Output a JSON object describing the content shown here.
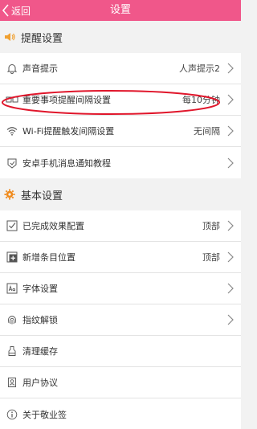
{
  "header": {
    "back_label": "返回",
    "title": "设置"
  },
  "sections": {
    "reminder": {
      "title": "提醒设置",
      "rows": [
        {
          "label": "声音提示",
          "value": "人声提示2"
        },
        {
          "label": "重要事项提醒间隔设置",
          "value": "每10分钟"
        },
        {
          "label": "Wi-Fi提醒触发间隔设置",
          "value": "无间隔"
        },
        {
          "label": "安卓手机消息通知教程",
          "value": ""
        }
      ]
    },
    "basic": {
      "title": "基本设置",
      "rows": [
        {
          "label": "已完成效果配置",
          "value": "顶部"
        },
        {
          "label": "新增条目位置",
          "value": "顶部"
        },
        {
          "label": "字体设置",
          "value": ""
        },
        {
          "label": "指纹解锁",
          "value": ""
        },
        {
          "label": "清理缓存",
          "value": ""
        },
        {
          "label": "用户协议",
          "value": ""
        },
        {
          "label": "关于敬业签",
          "value": ""
        }
      ]
    }
  },
  "colors": {
    "accent": "#f0578a",
    "reminder_icon": "#f0a030",
    "basic_icon": "#f08a1c",
    "highlight": "#e0162b"
  }
}
